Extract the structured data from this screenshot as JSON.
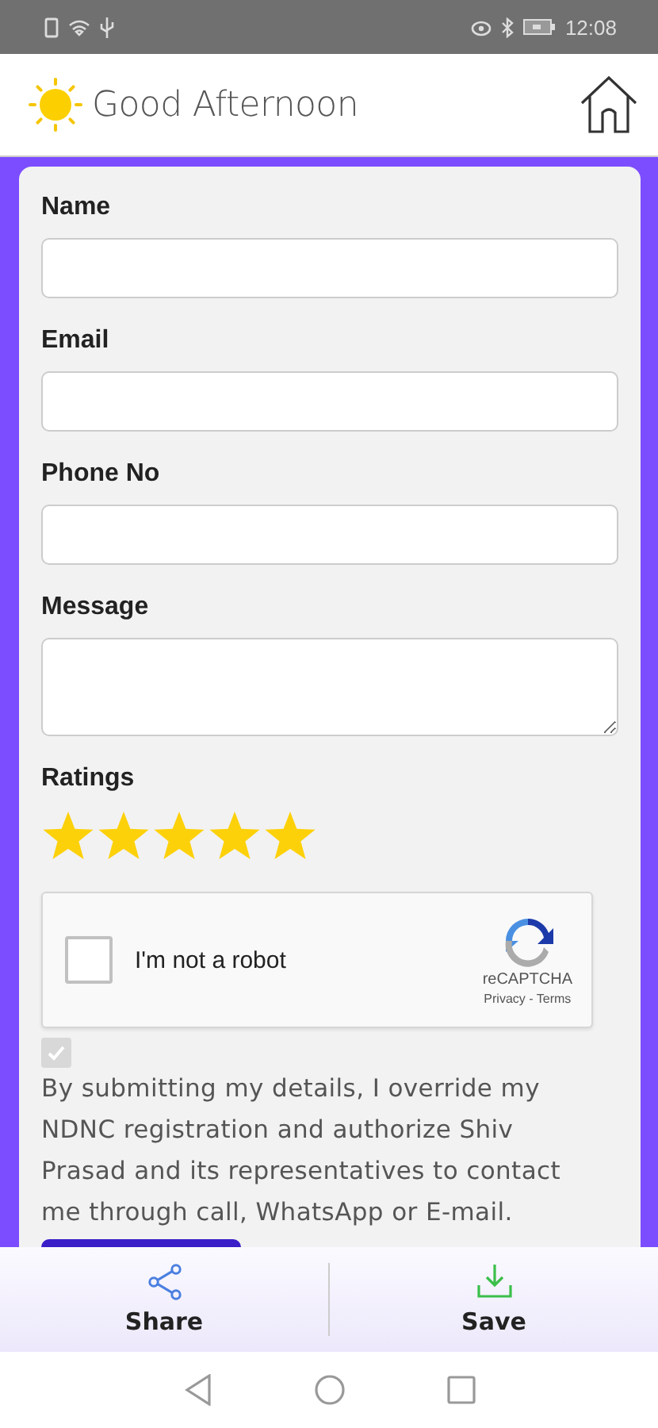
{
  "status_bar": {
    "time": "12:08"
  },
  "header": {
    "greeting": "Good Afternoon"
  },
  "form": {
    "fields": [
      {
        "label": "Name",
        "kind": "text"
      },
      {
        "label": "Email",
        "kind": "text"
      },
      {
        "label": "Phone No",
        "kind": "text"
      },
      {
        "label": "Message",
        "kind": "textarea"
      }
    ],
    "ratings": {
      "label": "Ratings",
      "stars": 5
    },
    "captcha": {
      "label": "I'm not a robot",
      "checked": false,
      "brand": "reCAPTCHA",
      "links": "Privacy - Terms"
    },
    "consent": {
      "checked": true,
      "disabled": true,
      "text": "By submitting my details, I override my NDNC registration and authorize Shiv Prasad and its representatives to contact me through call, WhatsApp or E-mail."
    }
  },
  "bottom_bar": [
    {
      "label": "Share",
      "kind": "share"
    },
    {
      "label": "Save",
      "kind": "save"
    }
  ]
}
